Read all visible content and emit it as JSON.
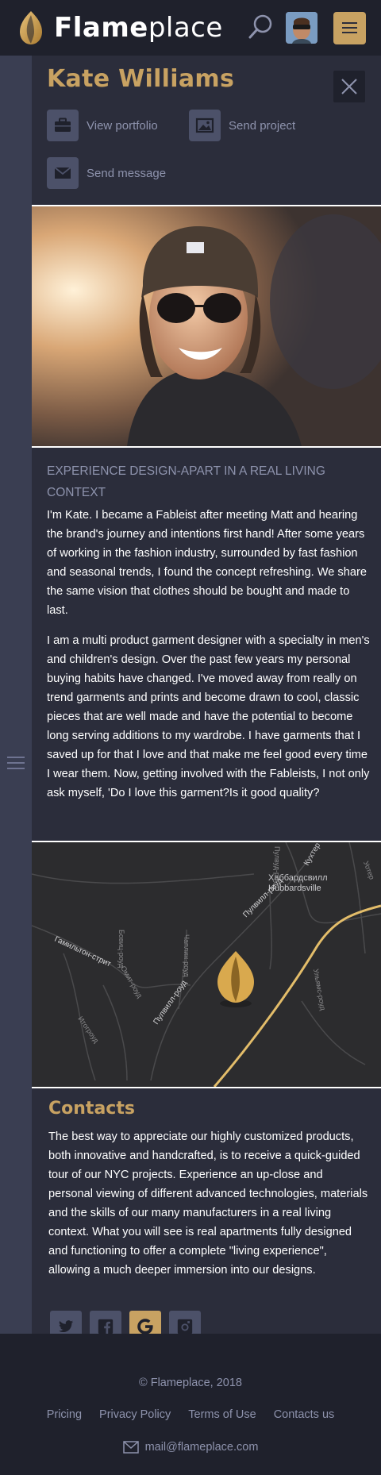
{
  "header": {
    "logo_bold": "Flame",
    "logo_light": "place",
    "icons": {
      "logo": "flame-icon",
      "search": "search-icon",
      "menu": "hamburger-menu-icon"
    }
  },
  "rail": {
    "icon": "hamburger-icon"
  },
  "profile": {
    "name": "Kate Williams",
    "actions": [
      {
        "label": "View portfolio",
        "icon": "briefcase-icon"
      },
      {
        "label": "Send project",
        "icon": "image-icon"
      },
      {
        "label": "Send message",
        "icon": "envelope-icon"
      }
    ],
    "close_icon": "close-icon"
  },
  "bio": {
    "heading": "EXPERIENCE DESIGN-APART IN A REAL LIVING CONTEXT",
    "paragraph1": "I'm Kate. I became a Fableist after meeting Matt and hearing the brand's journey and intentions first hand! After some years of working in the fashion industry, surrounded by fast fashion and seasonal trends, I found the concept refreshing. We share the same vision that clothes should be bought and made to last.",
    "paragraph2": "I am a multi product garment designer with a specialty in men's and children's design. Over the past few years my personal buying habits have changed. I've moved away from really on trend garments and prints and become drawn to cool, classic pieces that are well made and have the potential to become long serving additions to my wardrobe. I have garments that I saved up for that I love and that make me feel good every time I wear them. Now, getting involved with the Fableists, I not only ask myself, 'Do I love this garment?Is it good quality?"
  },
  "map": {
    "labels": {
      "district_ru": "Хаббардсвилл",
      "district_en": "Hubbardsville",
      "street1": "Гамильтон-стрит",
      "street2": "Пулвилл-роуд",
      "street3": "Пулвилл-роуд",
      "street4": "Кухтер",
      "street5": "Бовиц-роуд",
      "street6": "Омит-роуд",
      "street7": "Итогроуд",
      "street8": "Чаплин-роуд",
      "street9": "Ульямс-роуд",
      "street10": "Пулвуд-роуд",
      "street11": "Уотер"
    },
    "marker_icon": "flame-marker-icon"
  },
  "contacts": {
    "title": "Contacts",
    "text": "The best way to appreciate our highly customized products, both innovative and handcrafted, is to receive a quick-guided tour of our NYC projects. Experience an up-close and personal viewing of different advanced technologies, materials and the skills of our many manufacturers in a real living context. What you will see is real apartments fully designed and functioning to offer a complete \"living experience\", allowing a much deeper immersion into our designs.",
    "socials": [
      "twitter-icon",
      "facebook-icon",
      "google-icon",
      "instagram-icon"
    ]
  },
  "footer": {
    "copyright": "© Flameplace, 2018",
    "links": [
      "Pricing",
      "Privacy Policy",
      "Terms of Use",
      "Contacts us"
    ],
    "email": "mail@flameplace.com"
  },
  "colors": {
    "accent": "#c8a262",
    "background": "#2b2d3b",
    "header": "#1f212c",
    "muted_text": "#8e93ad",
    "icon_bg": "#4c5169"
  }
}
